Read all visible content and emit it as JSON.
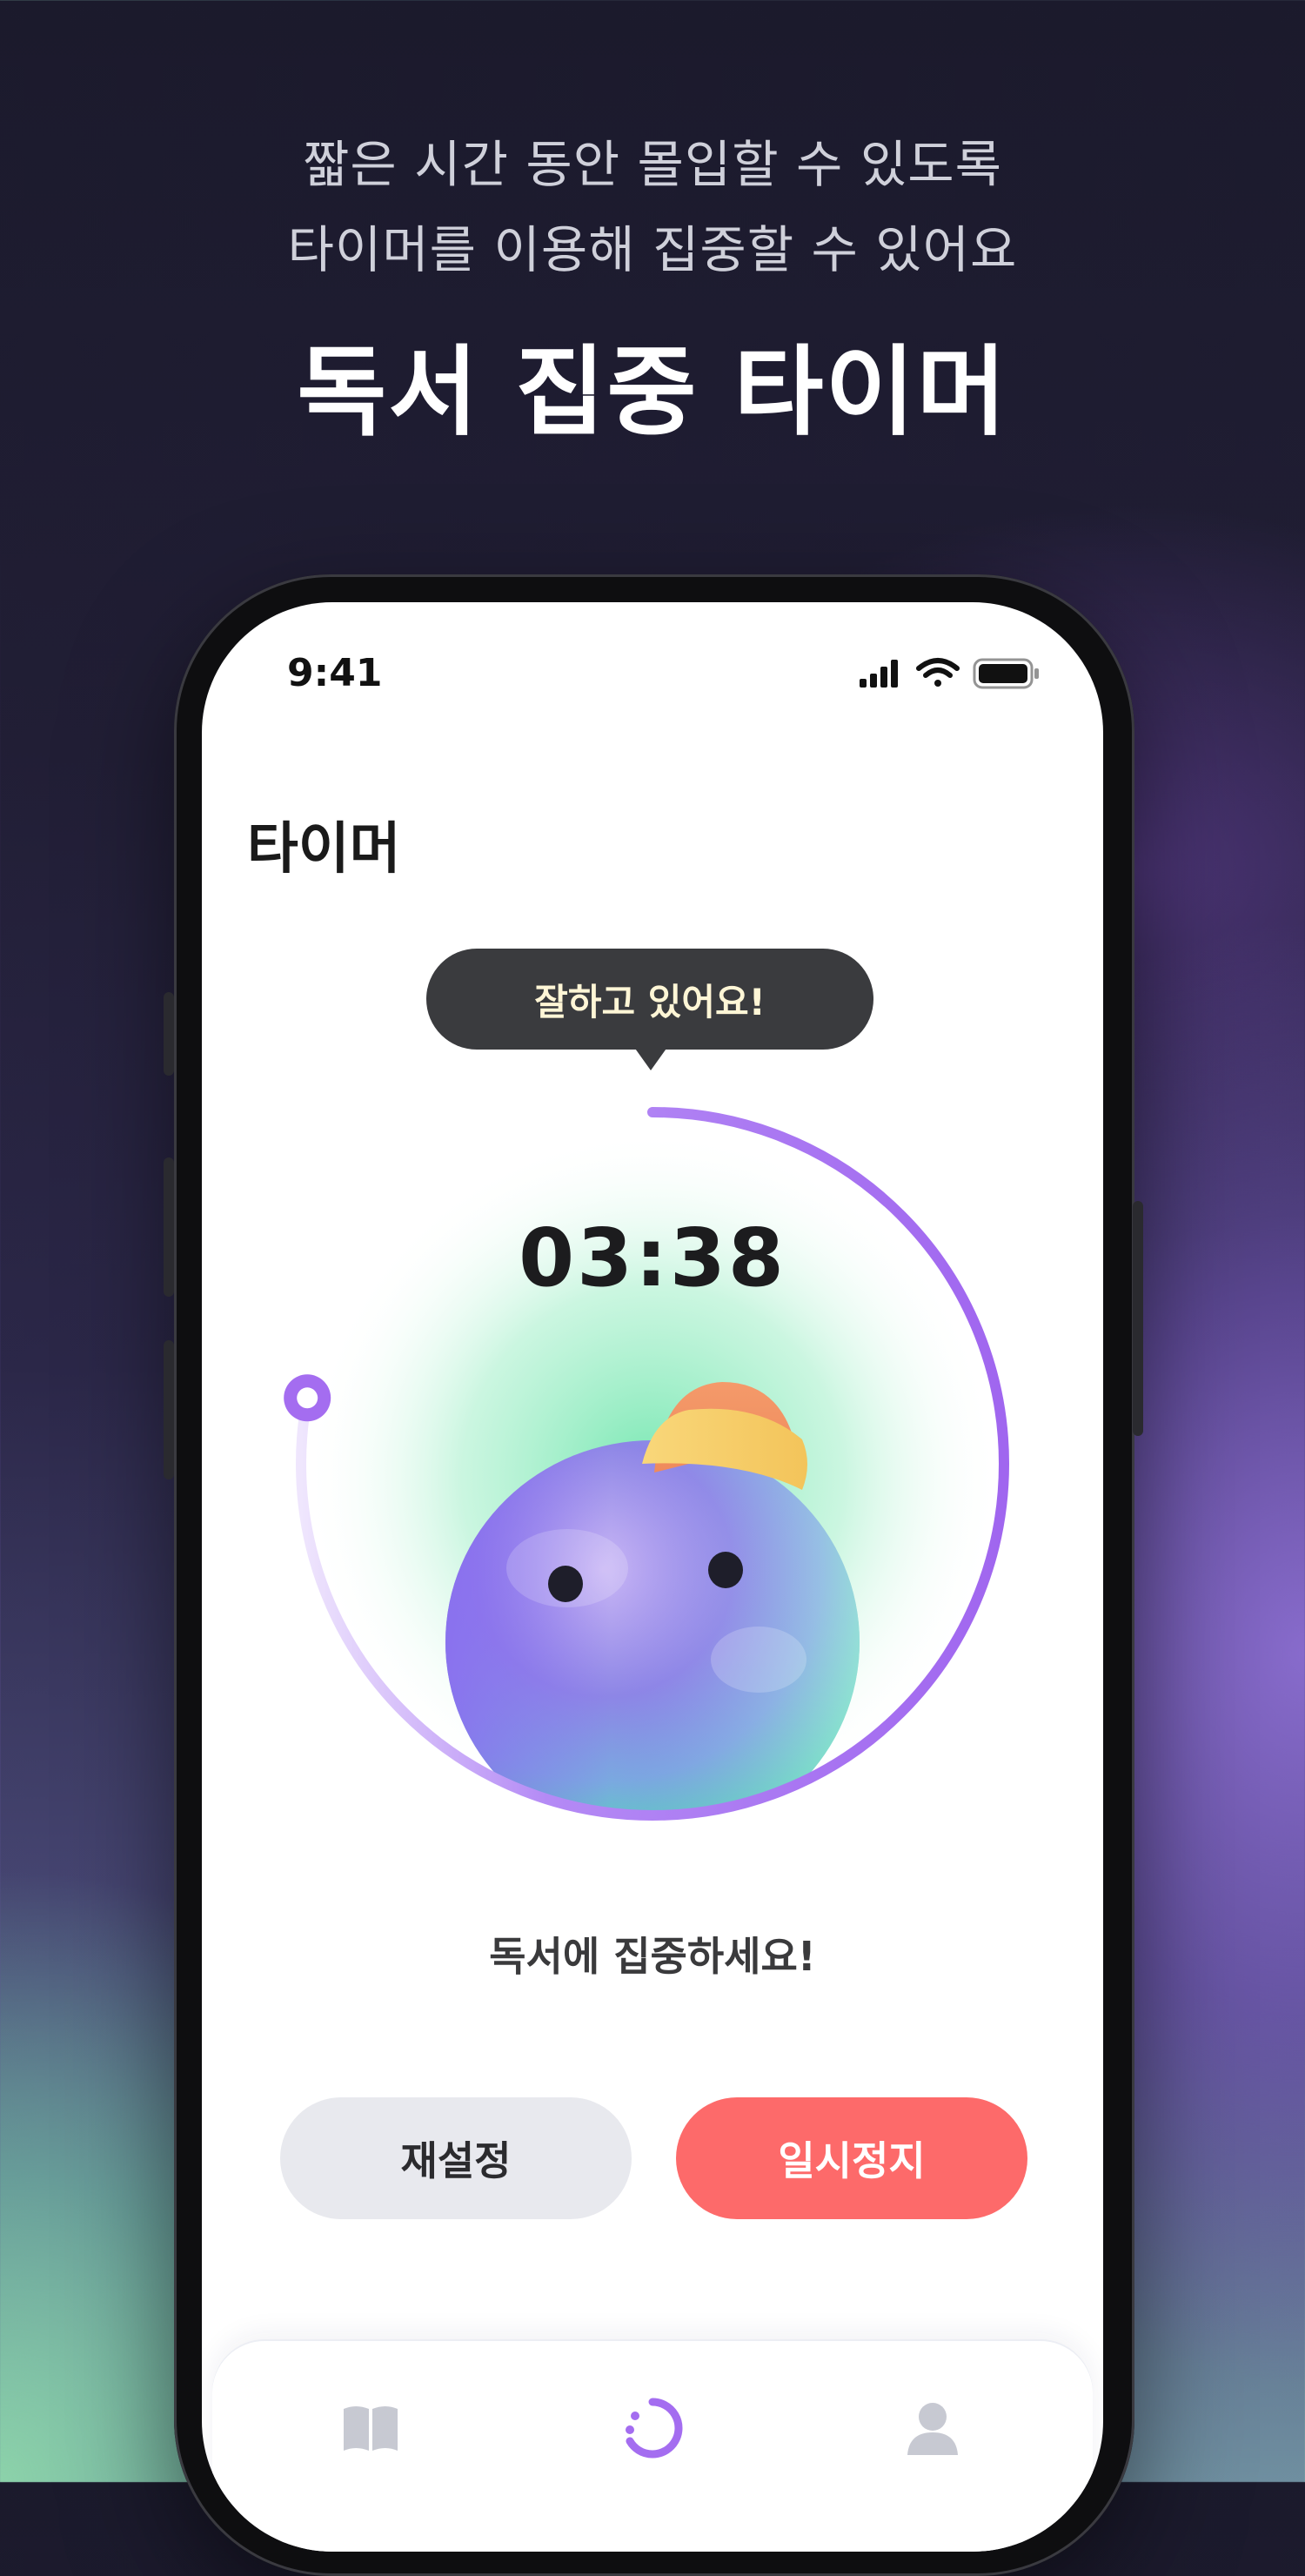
{
  "hero": {
    "line1": "짧은 시간 동안 몰입할 수 있도록",
    "line2": "타이머를 이용해 집중할 수 있어요",
    "title": "독서 집중 타이머"
  },
  "status_bar": {
    "time": "9:41",
    "icons": [
      "signal-icon",
      "wifi-icon",
      "battery-icon"
    ]
  },
  "page": {
    "title": "타이머"
  },
  "timer": {
    "bubble_text": "잘하고 있어요!",
    "time_display": "03:38",
    "progress": 0.78,
    "message": "독서에 집중하세요!"
  },
  "buttons": {
    "reset_label": "재설정",
    "pause_label": "일시정지"
  },
  "tabbar": {
    "items": [
      {
        "icon": "book-icon",
        "active": false
      },
      {
        "icon": "timer-icon",
        "active": true
      },
      {
        "icon": "profile-icon",
        "active": false
      }
    ]
  },
  "colors": {
    "accent": "#a46df0",
    "pause_button": "#fd6a6a",
    "reset_button": "#e8e9ee"
  }
}
